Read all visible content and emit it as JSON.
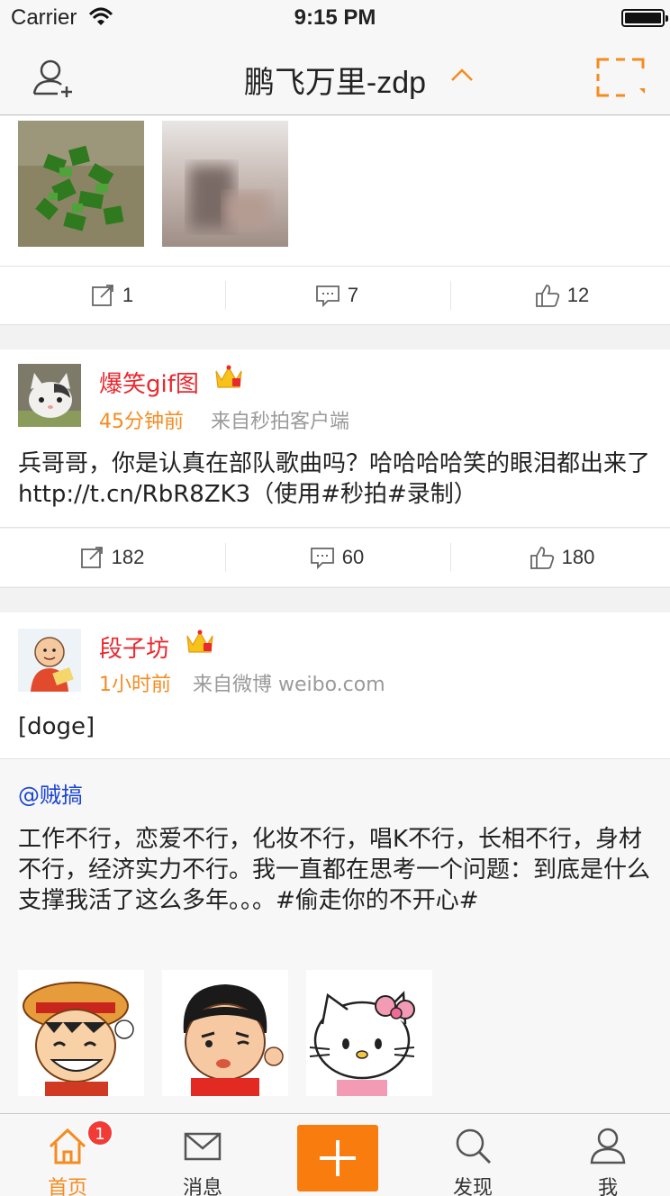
{
  "status_bar": {
    "carrier": "Carrier",
    "time": "9:15 PM"
  },
  "nav": {
    "title": "鹏飞万里-zdp"
  },
  "post_top": {
    "actions": {
      "repost": "1",
      "comment": "7",
      "like": "12"
    }
  },
  "post1": {
    "username": "爆笑gif图",
    "time": "45分钟前",
    "source": "来自秒拍客户端",
    "text": "兵哥哥，你是认真在部队歌曲吗？哈哈哈哈笑的眼泪都出来了http://t.cn/RbR8ZK3（使用#秒拍#录制）",
    "actions": {
      "repost": "182",
      "comment": "60",
      "like": "180"
    }
  },
  "post2": {
    "username": "段子坊",
    "time": "1小时前",
    "source": "来自微博 weibo.com",
    "text": "[doge]",
    "retweet": {
      "mention": "@贼搞",
      "text": "工作不行，恋爱不行，化妆不行，唱K不行，长相不行，身材不行，经济实力不行。我一直都在思考一个问题：到底是什么支撑我活了这么多年。。。#偷走你的不开心#"
    }
  },
  "tabbar": {
    "home": "首页",
    "home_badge": "1",
    "messages": "消息",
    "discover": "发现",
    "me": "我"
  },
  "colors": {
    "accent": "#f97d0e",
    "username": "#e8292f",
    "time": "#f68b1f",
    "mention": "#1a44d6",
    "badge": "#f23b37"
  }
}
